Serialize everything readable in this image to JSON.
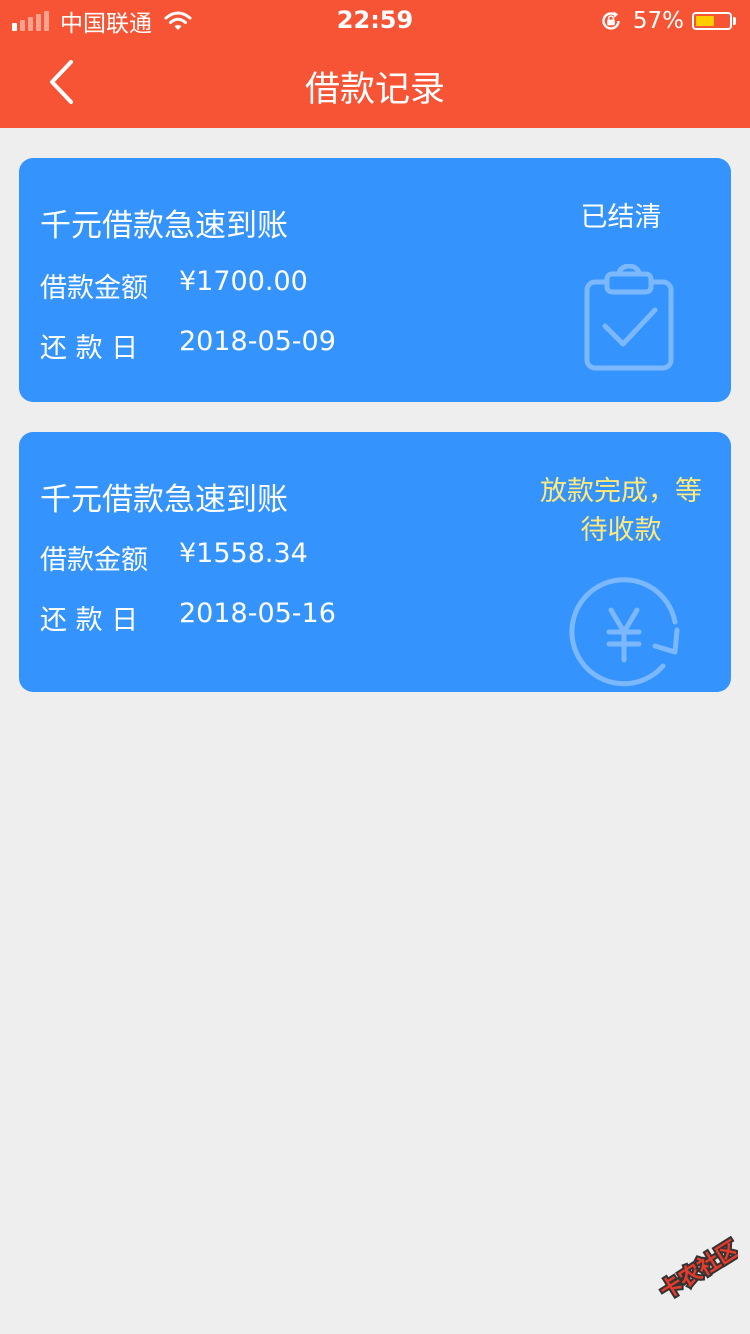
{
  "status_bar": {
    "carrier": "中国联通",
    "time": "22:59",
    "battery_percent": "57%",
    "battery_level": 0.57
  },
  "nav": {
    "title": "借款记录"
  },
  "loans": [
    {
      "title": "千元借款急速到账",
      "amount_label": "借款金额",
      "amount": "¥1700.00",
      "due_label": "还 款 日",
      "due_date": "2018-05-09",
      "status": "已结清",
      "status_icon": "clipboard-check-icon"
    },
    {
      "title": "千元借款急速到账",
      "amount_label": "借款金额",
      "amount": "¥1558.34",
      "due_label": "还 款 日",
      "due_date": "2018-05-16",
      "status": "放款完成，等待收款",
      "status_icon": "yuan-refresh-icon"
    }
  ],
  "watermark": {
    "text": "卡农社区"
  },
  "colors": {
    "header": "#f75436",
    "card": "#3593fe",
    "background": "#eeeeee",
    "pending_status": "#ffe97a",
    "battery": "#ffcc00"
  }
}
